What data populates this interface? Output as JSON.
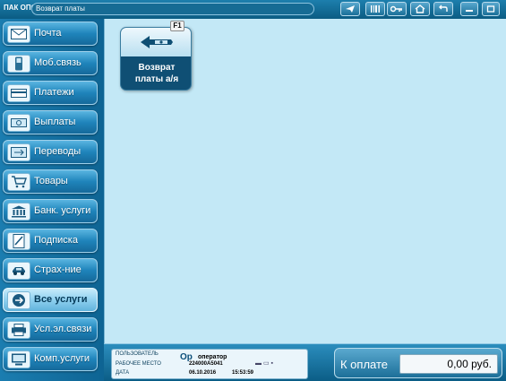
{
  "window": {
    "app_title": "ПАК ОПС",
    "breadcrumb": "Возврат платы"
  },
  "toolbar": {
    "buttons": [
      {
        "icon": "send-icon"
      },
      {
        "icon": "barcode-icon"
      },
      {
        "icon": "key-icon"
      },
      {
        "icon": "home-icon"
      },
      {
        "icon": "back-arrow-icon"
      },
      {
        "icon": "minimize-icon"
      },
      {
        "icon": "maximize-icon"
      }
    ]
  },
  "sidebar": {
    "items": [
      {
        "label": "Почта",
        "icon": "envelope-icon"
      },
      {
        "label": "Моб.связь",
        "icon": "mobile-phone-icon"
      },
      {
        "label": "Платежи",
        "icon": "payment-icon"
      },
      {
        "label": "Выплаты",
        "icon": "banknote-icon"
      },
      {
        "label": "Переводы",
        "icon": "transfer-icon"
      },
      {
        "label": "Товары",
        "icon": "cart-icon"
      },
      {
        "label": "Банк. услуги",
        "icon": "bank-icon"
      },
      {
        "label": "Подписка",
        "icon": "subscription-icon"
      },
      {
        "label": "Страх-ние",
        "icon": "insurance-car-icon"
      },
      {
        "label": "Все услуги",
        "icon": "all-services-icon",
        "active": true
      },
      {
        "label": "Усл.эл.связи",
        "icon": "printer-icon"
      },
      {
        "label": "Комп.услуги",
        "icon": "computer-icon"
      }
    ]
  },
  "main": {
    "tile": {
      "line1": "Возврат",
      "line2": "платы а/я",
      "hotkey": "F1",
      "icon": "refund-arrow-icon"
    }
  },
  "status": {
    "user_label": "ПОЛЬЗОВАТЕЛЬ",
    "user_glyph": "Ор",
    "user_value": "оператор",
    "workplace_label": "РАБОЧЕЕ МЕСТО",
    "workplace_value": "224000А5041",
    "date_label": "ДАТА",
    "date_value": "06.10.2016",
    "time_value": "15:53:59",
    "pay_label": "К оплате",
    "pay_value": "0,00 руб."
  },
  "colors": {
    "frame": "#0c5f86",
    "main_bg": "#c3e8f6",
    "tile_bg": "#0f4f74"
  }
}
